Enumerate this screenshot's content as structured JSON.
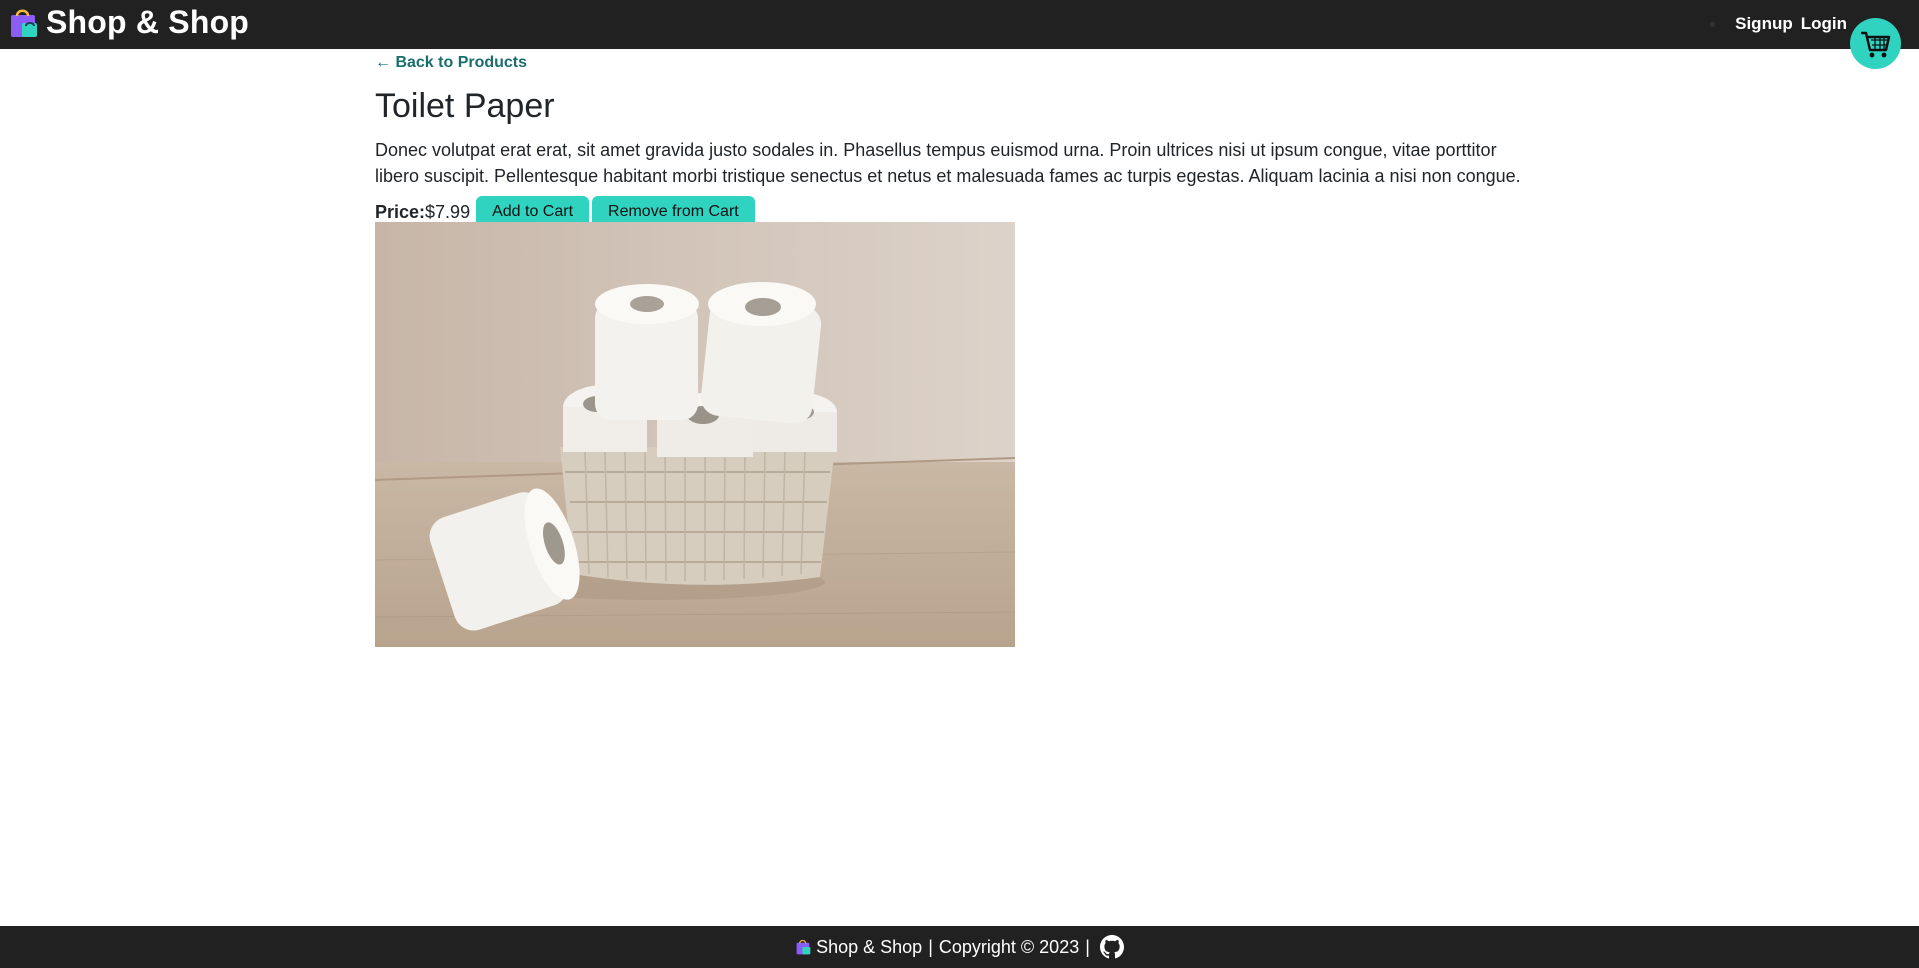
{
  "header": {
    "brand_name": "Shop & Shop",
    "nav": {
      "signup": "Signup",
      "login": "Login"
    }
  },
  "product": {
    "back_link": "← Back to Products",
    "title": "Toilet Paper",
    "description": "Donec volutpat erat erat, sit amet gravida justo sodales in. Phasellus tempus euismod urna. Proin ultrices nisi ut ipsum congue, vitae porttitor libero suscipit. Pellentesque habitant morbi tristique senectus et netus et malesuada fames ac turpis egestas. Aliquam lacinia a nisi non congue.",
    "price_label": "Price:",
    "price_value": "$7.99",
    "add_to_cart": "Add to Cart",
    "remove_from_cart": "Remove from Cart"
  },
  "footer": {
    "brand": "Shop & Shop",
    "separator": "|",
    "copyright": "Copyright © 2023",
    "separator2": "|"
  },
  "colors": {
    "header_bg": "#212121",
    "accent": "#2fd3c0",
    "link": "#1b6e6e"
  },
  "icons": {
    "logo": "shopping-bag-icon",
    "cart": "shopping-cart-icon",
    "github": "github-icon"
  }
}
